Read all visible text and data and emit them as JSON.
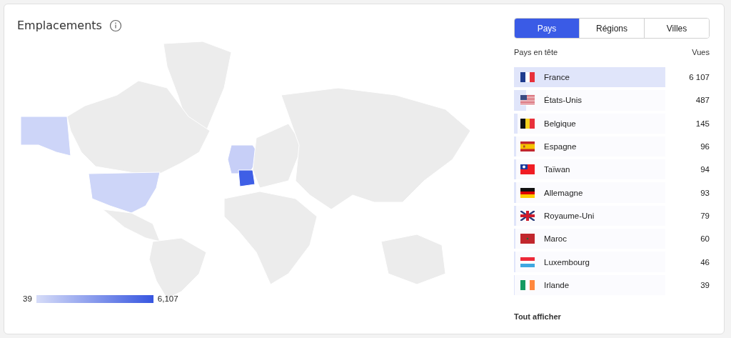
{
  "card": {
    "title": "Emplacements"
  },
  "legend": {
    "min": "39",
    "max": "6,107"
  },
  "tabs": [
    {
      "label": "Pays",
      "selected": true
    },
    {
      "label": "Régions",
      "selected": false
    },
    {
      "label": "Villes",
      "selected": false
    }
  ],
  "table": {
    "columns": [
      "Pays en tête",
      "Vues"
    ],
    "rows": [
      {
        "kind": "fr",
        "name": "France",
        "views": "6 107",
        "level": 1
      },
      {
        "kind": "us",
        "name": "États-Unis",
        "views": "487",
        "level": 0.08
      },
      {
        "kind": "be",
        "name": "Belgique",
        "views": "145",
        "level": 0.024
      },
      {
        "kind": "es",
        "name": "Espagne",
        "views": "96",
        "level": 0.016
      },
      {
        "kind": "tw",
        "name": "Taïwan",
        "views": "94",
        "level": 0.015
      },
      {
        "kind": "de",
        "name": "Allemagne",
        "views": "93",
        "level": 0.015
      },
      {
        "kind": "gb",
        "name": "Royaume-Uni",
        "views": "79",
        "level": 0.013
      },
      {
        "kind": "ma",
        "name": "Maroc",
        "views": "60",
        "level": 0.01
      },
      {
        "kind": "lu",
        "name": "Luxembourg",
        "views": "46",
        "level": 0.008
      },
      {
        "kind": "ie",
        "name": "Irlande",
        "views": "39",
        "level": 0.006
      }
    ]
  },
  "footer_link": "Tout afficher"
}
